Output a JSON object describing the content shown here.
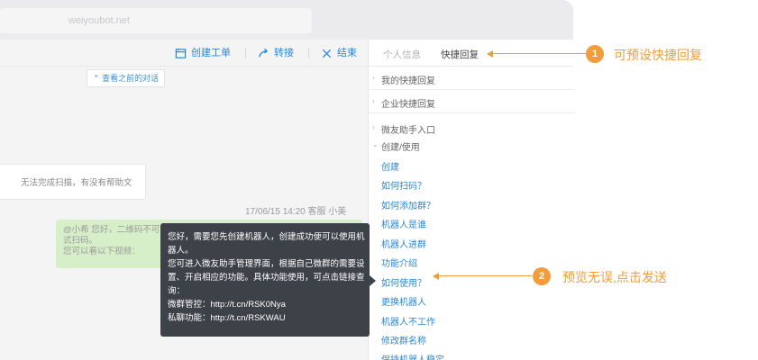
{
  "browser": {
    "url": "weiyoubot.net"
  },
  "toolbar": {
    "create_ticket": "创建工单",
    "transfer": "转接",
    "end": "结束"
  },
  "chat": {
    "history_button": "查看之前的对话",
    "left_message": "无法完成扫描，有没有帮助文",
    "meta": "17/06/15 14:20  客服 小美",
    "green_lines": [
      "@小希 您好，二维码不可",
      "式扫码。",
      "您可以看以下视频："
    ]
  },
  "tooltip": {
    "lines": [
      "您好，需要您先创建机器人，创建成功便可以使用机",
      "器人。",
      "您可进入微友助手管理界面，根据自己微群的需要设",
      "置、开启相应的功能。具体功能使用，可点击链接查",
      "询：",
      "微群管控：http://t.cn/RSK0Nya",
      "私聊功能：http://t.cn/RSKWAU"
    ]
  },
  "panel": {
    "tabs": {
      "info": "个人信息",
      "quick_reply": "快捷回复"
    },
    "groups": [
      {
        "arrow": "›",
        "label": "我的快捷回复"
      },
      {
        "arrow": "›",
        "label": "企业快捷回复"
      }
    ],
    "subgroups": [
      {
        "arrow": "›",
        "label": "微友助手入口"
      },
      {
        "arrow": "⌄",
        "label": "创建/使用"
      }
    ],
    "items": [
      "创建",
      "如何扫码？",
      "如何添加群？",
      "机器人是谁",
      "机器人进群",
      "功能介绍",
      "如何使用？",
      "更换机器人",
      "机器人不工作",
      "修改群名称",
      "保持机器人稳定"
    ]
  },
  "callouts": [
    {
      "num": "1",
      "text": "可预设快捷回复"
    },
    {
      "num": "2",
      "text": "预览无误,点击发送"
    }
  ],
  "colors": {
    "accent": "#2c86d4",
    "callout": "#f39c3b",
    "tooltip_bg": "#3d4148",
    "green_bubble": "#d6efc8"
  }
}
